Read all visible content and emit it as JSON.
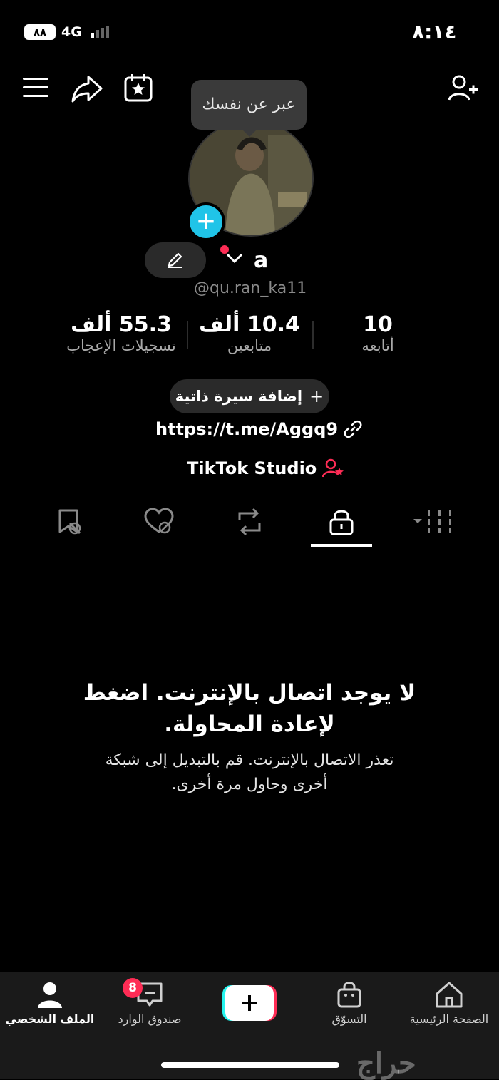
{
  "status": {
    "time": "٨:١٤",
    "battery": "٨٨",
    "network": "4G"
  },
  "tooltip": "عبر عن نفسك",
  "profile": {
    "name": "a",
    "handle": "@qu.ran_ka11",
    "stats": [
      {
        "value": "55.3 ألف",
        "label": "تسجيلات الإعجاب"
      },
      {
        "value": "10.4 ألف",
        "label": "متابعين"
      },
      {
        "value": "10",
        "label": "أتابعه"
      }
    ],
    "add_bio": "إضافة سيرة ذاتية",
    "link": "https://t.me/Aggq9",
    "studio": "TikTok Studio"
  },
  "empty_state": {
    "title": "لا يوجد اتصال بالإنترنت. اضغط لإعادة المحاولة.",
    "body": "تعذر الاتصال بالإنترنت. قم بالتبديل إلى شبكة أخرى وحاول مرة أخرى."
  },
  "nav": {
    "profile": "الملف الشخصي",
    "inbox": "صندوق الوارد",
    "inbox_badge": "8",
    "shop": "التسوّق",
    "home": "الصفحة الرئيسية"
  },
  "watermark": "حراج"
}
